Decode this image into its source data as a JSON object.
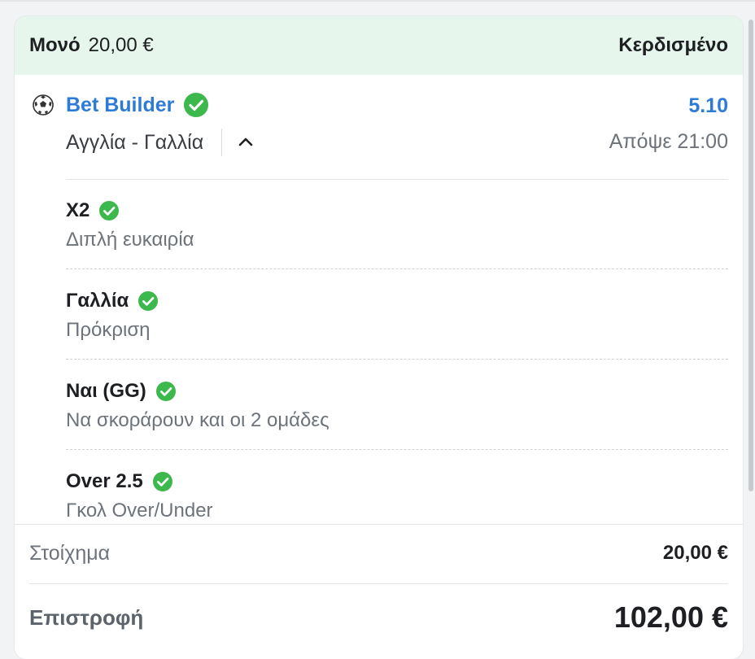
{
  "header": {
    "bet_type": "Μονό",
    "amount": "20,00 €",
    "status": "Κερδισμένο"
  },
  "event": {
    "sport_icon": "soccer-ball-icon",
    "title": "Bet Builder",
    "odds": "5.10",
    "match": "Αγγλία - Γαλλία",
    "time": "Απόψε 21:00"
  },
  "selections": [
    {
      "name": "X2",
      "market": "Διπλή ευκαιρία"
    },
    {
      "name": "Γαλλία",
      "market": "Πρόκριση"
    },
    {
      "name": "Ναι (GG)",
      "market": "Να σκοράρουν και οι 2 ομάδες"
    },
    {
      "name": "Over 2.5",
      "market": "Γκολ Over/Under"
    }
  ],
  "footer": {
    "stake_label": "Στοίχημα",
    "stake_value": "20,00 €",
    "return_label": "Επιστροφή",
    "return_value": "102,00 €"
  },
  "colors": {
    "header_bg": "#e6f6ec",
    "accent_blue": "#2e7bd6",
    "check_green": "#3cb84c"
  }
}
